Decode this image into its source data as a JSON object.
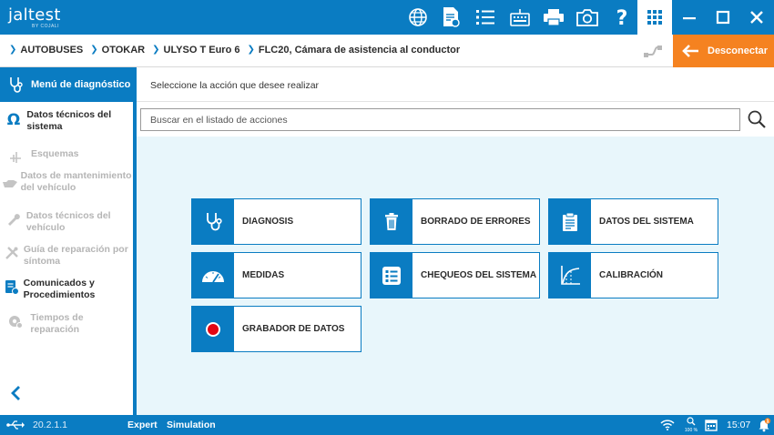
{
  "brand": {
    "name": "jaltest",
    "tagline": "BY COJALI"
  },
  "toolbar": {
    "icons": [
      "globe-icon",
      "document-settings-icon",
      "checklist-icon",
      "keyboard-icon",
      "printer-icon",
      "camera-icon",
      "help-icon",
      "apps-grid-icon"
    ],
    "window_controls": [
      "minimize-icon",
      "maximize-icon",
      "close-icon"
    ]
  },
  "breadcrumb": [
    "AUTOBUSES",
    "OTOKAR",
    "ULYSO T Euro 6",
    "FLC20, Cámara de asistencia al conductor"
  ],
  "disconnect": {
    "label": "Desconectar",
    "color": "#f58220"
  },
  "sidebar": {
    "header": "Menú de diagnóstico",
    "items": [
      {
        "label": "Datos técnicos del sistema",
        "enabled": true,
        "icon": "omega-icon"
      },
      {
        "label": "Esquemas",
        "enabled": false,
        "icon": "schema-icon"
      },
      {
        "label": "Datos de mantenimiento del vehículo",
        "enabled": false,
        "icon": "oil-can-icon"
      },
      {
        "label": "Datos técnicos del vehículo",
        "enabled": false,
        "icon": "wrench-icon"
      },
      {
        "label": "Guía de reparación por síntoma",
        "enabled": false,
        "icon": "tools-icon"
      },
      {
        "label": "Comunicados y Procedimientos",
        "enabled": true,
        "icon": "bulletin-icon"
      },
      {
        "label": "Tiempos de reparación",
        "enabled": false,
        "icon": "gear-clock-icon"
      }
    ]
  },
  "main": {
    "instruction": "Seleccione la acción que desee realizar",
    "search_placeholder": "Buscar en el listado de acciones"
  },
  "actions": [
    {
      "label": "DIAGNOSIS",
      "icon": "stethoscope-icon"
    },
    {
      "label": "BORRADO DE ERRORES",
      "icon": "trash-icon"
    },
    {
      "label": "DATOS DEL SISTEMA",
      "icon": "clipboard-icon"
    },
    {
      "label": "MEDIDAS",
      "icon": "gauge-icon"
    },
    {
      "label": "CHEQUEOS DEL SISTEMA",
      "icon": "checklist-icon"
    },
    {
      "label": "CALIBRACIÓN",
      "icon": "curve-icon"
    },
    {
      "label": "GRABADOR DE DATOS",
      "icon": "record-icon"
    }
  ],
  "statusbar": {
    "version": "20.2.1.1",
    "mode": "Expert",
    "simulation": "Simulation",
    "zoom": "100 %",
    "time": "15:07",
    "notifications": "1"
  },
  "colors": {
    "primary": "#0a7cc2",
    "accent": "#f58220",
    "canvas": "#e8f6fb",
    "record": "#e30613"
  }
}
